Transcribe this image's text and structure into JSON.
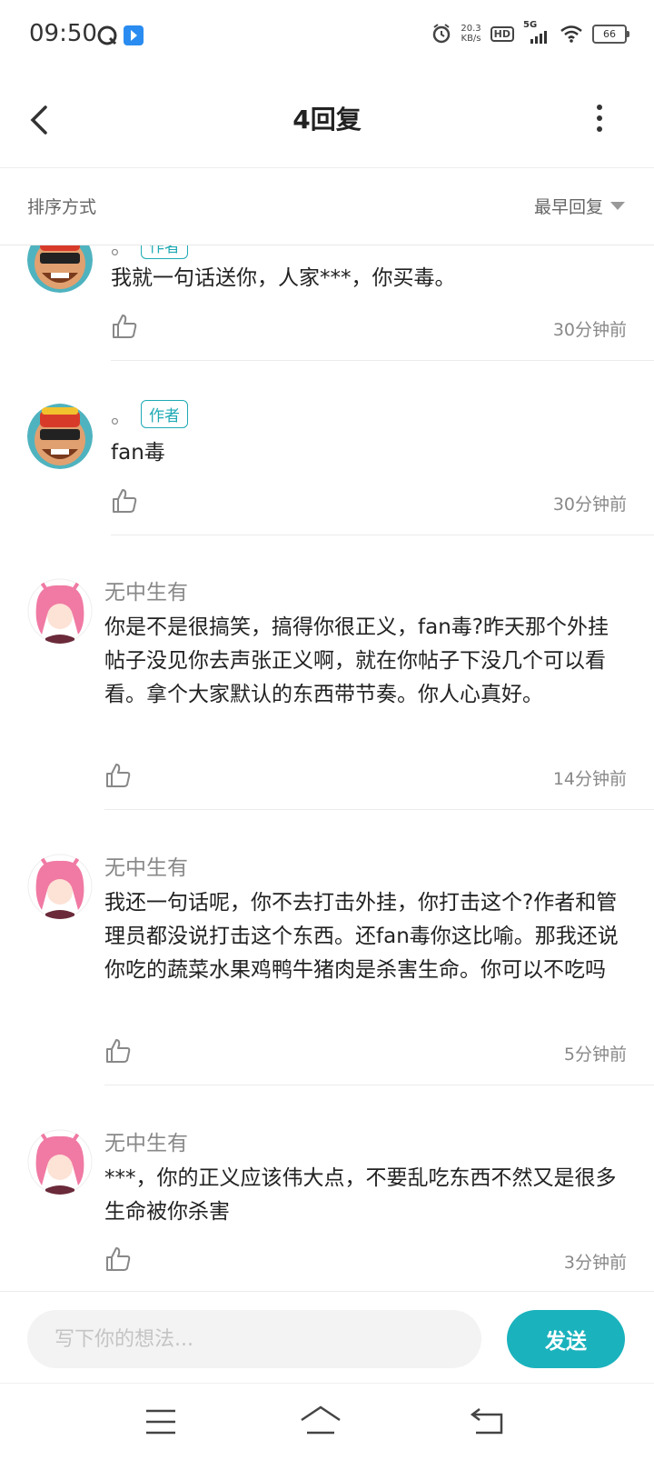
{
  "status_bar": {
    "time": "09:50",
    "net_speed_value": "20.3",
    "net_speed_unit": "KB/s",
    "hd_label": "HD",
    "network_label": "5G",
    "battery_level": "66",
    "icons": [
      "qq-icon",
      "app-icon",
      "alarm-icon",
      "hd-icon",
      "signal-icon",
      "wifi-icon",
      "battery-icon"
    ]
  },
  "header": {
    "title": "4回复"
  },
  "sort_bar": {
    "label": "排序方式",
    "selected": "最早回复"
  },
  "replies": [
    {
      "username": "。",
      "badge": "作者",
      "text": "我就一句话送你，人家***，你买毒。",
      "time": "30分钟前"
    },
    {
      "username": "。",
      "badge": "作者",
      "text": "fan毒",
      "time": "30分钟前"
    },
    {
      "username": "无中生有",
      "badge": "",
      "text": "你是不是很搞笑，搞得你很正义，fan毒?昨天那个外挂帖子没见你去声张正义啊，就在你帖子下没几个可以看看。拿个大家默认的东西带节奏。你人心真好。",
      "time": "14分钟前"
    },
    {
      "username": "无中生有",
      "badge": "",
      "text": "我还一句话呢，你不去打击外挂，你打击这个?作者和管理员都没说打击这个东西。还fan毒你这比喻。那我还说你吃的蔬菜水果鸡鸭牛猪肉是杀害生命。你可以不吃吗",
      "time": "5分钟前"
    },
    {
      "username": "无中生有",
      "badge": "",
      "text": "***，你的正义应该伟大点，不要乱吃东西不然又是很多生命被你杀害",
      "time": "3分钟前"
    }
  ],
  "composer": {
    "placeholder": "写下你的想法...",
    "send_label": "发送"
  },
  "colors": {
    "accent": "#1ab2bd",
    "badge": "#20aab5",
    "muted_text": "#888888"
  }
}
